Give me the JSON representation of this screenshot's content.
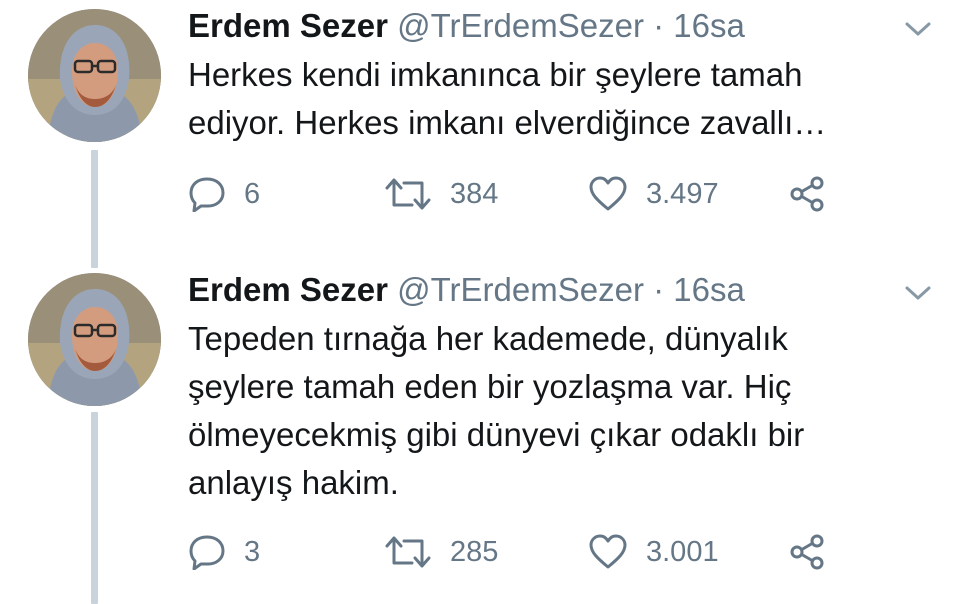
{
  "tweets": [
    {
      "author_name": "Erdem Sezer",
      "handle": "@TrErdemSezer",
      "separator": "·",
      "time": "16sa",
      "lines": [
        "Herkes kendi imkanınca bir şeylere tamah",
        "ediyor. Herkes imkanı elverdiğince zavallı…"
      ],
      "replies": "6",
      "retweets": "384",
      "likes": "3.497"
    },
    {
      "author_name": "Erdem Sezer",
      "handle": "@TrErdemSezer",
      "separator": "·",
      "time": "16sa",
      "lines": [
        "Tepeden tırnağa her kademede, dünyalık",
        "şeylere tamah eden bir yozlaşma var. Hiç",
        "ölmeyecekmiş gibi dünyevi çıkar odaklı bir",
        "anlayış hakim."
      ],
      "replies": "3",
      "retweets": "285",
      "likes": "3.001"
    }
  ],
  "icons": {
    "reply": "reply-icon",
    "retweet": "retweet-icon",
    "like": "heart-icon",
    "share": "share-icon",
    "menu": "chevron-down-icon"
  },
  "colors": {
    "text": "#14171a",
    "secondary": "#657786",
    "thread_line": "#c9d3dc"
  }
}
